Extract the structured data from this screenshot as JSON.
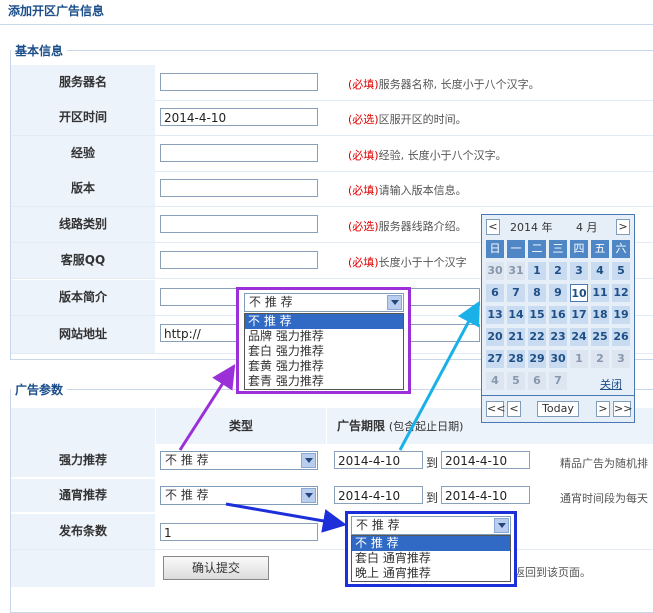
{
  "page_title": "添加开区广告信息",
  "basic_section": {
    "legend": "基本信息",
    "rows": [
      {
        "label": "服务器名",
        "value": "",
        "required": "(必填)",
        "hint": "服务器名称, 长度小于八个汉字。"
      },
      {
        "label": "开区时间",
        "value": "2014-4-10",
        "required": "(必选)",
        "hint": "区服开区的时间。"
      },
      {
        "label": "经验",
        "value": "",
        "required": "(必填)",
        "hint": "经验, 长度小于八个汉字。"
      },
      {
        "label": "版本",
        "value": "",
        "required": "(必填)",
        "hint": "请输入版本信息。"
      },
      {
        "label": "线路类别",
        "value": "",
        "required": "(必选)",
        "hint": "服务器线路介绍。"
      },
      {
        "label": "客服QQ",
        "value": "",
        "required": "(必填)",
        "hint": "长度小于十个汉字"
      },
      {
        "label": "版本简介",
        "value": "",
        "required": "",
        "hint": ""
      },
      {
        "label": "网站地址",
        "value": "http://",
        "required": "",
        "hint": ""
      }
    ]
  },
  "ad_section": {
    "legend": "广告参数",
    "col_type": "类型",
    "col_period": "广告期限",
    "col_period_note": "(包含起止日期)",
    "rows": [
      {
        "label": "强力推荐",
        "select": "不 推 荐",
        "start": "2014-4-10",
        "to": "到",
        "end": "2014-4-10",
        "note": "精品广告为随机排"
      },
      {
        "label": "通宵推荐",
        "select": "不 推 荐",
        "start": "2014-4-10",
        "to": "到",
        "end": "2014-4-10",
        "note": "通宵时间段为每天"
      }
    ],
    "count_label": "发布条数",
    "count_value": "1",
    "submit": "确认提交",
    "return_hint": "返回到该页面。"
  },
  "dropdown1": {
    "selected": "不 推 荐",
    "options": [
      "不 推 荐",
      "品牌 强力推荐",
      "套白 强力推荐",
      "套黄 强力推荐",
      "套青 强力推荐"
    ]
  },
  "dropdown2": {
    "selected": "不 推 荐",
    "options": [
      "不 推 荐",
      "套白 通宵推荐",
      "晚上 通宵推荐"
    ]
  },
  "calendar": {
    "prev_year": "<",
    "year": "2014",
    "year_unit": "年",
    "month": "4",
    "month_unit": "月",
    "next_year": ">",
    "weekdays": [
      "日",
      "一",
      "二",
      "三",
      "四",
      "五",
      "六"
    ],
    "days": [
      [
        "30",
        "31",
        "1",
        "2",
        "3",
        "4",
        "5"
      ],
      [
        "6",
        "7",
        "8",
        "9",
        "10",
        "11",
        "12"
      ],
      [
        "13",
        "14",
        "15",
        "16",
        "17",
        "18",
        "19"
      ],
      [
        "20",
        "21",
        "22",
        "23",
        "24",
        "25",
        "26"
      ],
      [
        "27",
        "28",
        "29",
        "30",
        "1",
        "2",
        "3"
      ],
      [
        "4",
        "5",
        "6",
        "7",
        "",
        "",
        ""
      ]
    ],
    "today_day": "10",
    "close": "关闭",
    "nav_prev_year": "<<",
    "nav_prev_month": "<",
    "today": "Today",
    "nav_next_month": ">",
    "nav_next_year": ">>"
  },
  "colors": {
    "accent": "#1b4e8a",
    "required": "#dd0000",
    "arrow_purple": "#9b30d9",
    "arrow_cyan": "#1ab0e8",
    "arrow_blue": "#1c2fd8"
  }
}
